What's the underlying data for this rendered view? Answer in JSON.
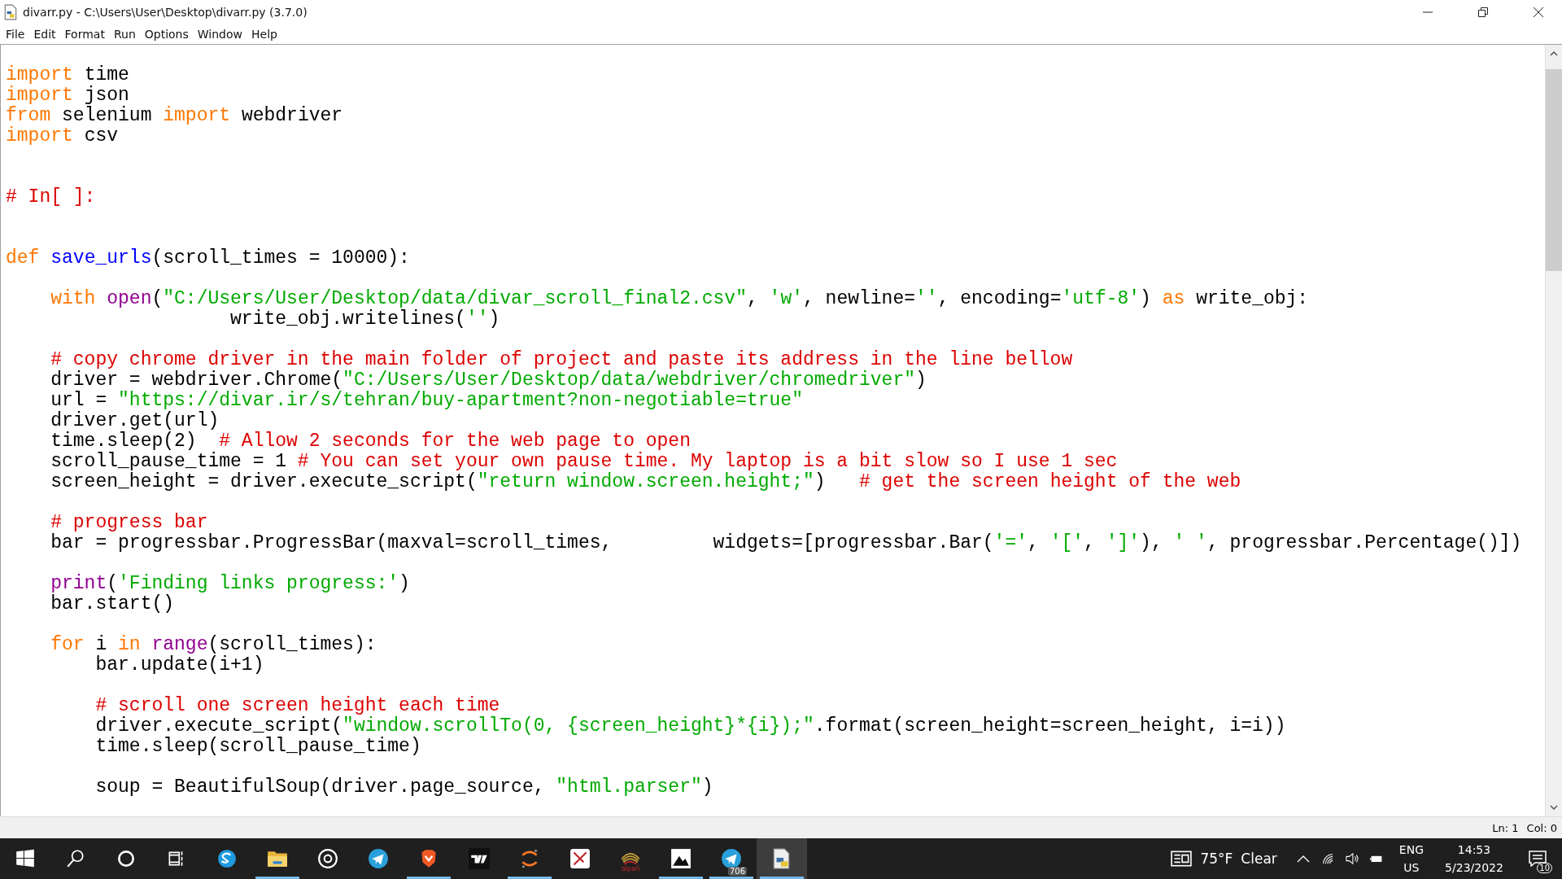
{
  "window": {
    "title": "divarr.py - C:\\Users\\User\\Desktop\\divarr.py (3.7.0)"
  },
  "menu": [
    "File",
    "Edit",
    "Format",
    "Run",
    "Options",
    "Window",
    "Help"
  ],
  "editor": {
    "blocks": [
      {
        "lines": [
          {
            "segments": [
              {
                "kind": "keyword",
                "text": "import"
              },
              {
                "kind": "plain",
                "text": " time"
              }
            ]
          },
          {
            "segments": [
              {
                "kind": "keyword",
                "text": "import"
              },
              {
                "kind": "plain",
                "text": " json"
              }
            ]
          },
          {
            "segments": [
              {
                "kind": "keyword",
                "text": "from"
              },
              {
                "kind": "plain",
                "text": " selenium "
              },
              {
                "kind": "keyword",
                "text": "import"
              },
              {
                "kind": "plain",
                "text": " webdriver"
              }
            ]
          },
          {
            "segments": [
              {
                "kind": "keyword",
                "text": "import"
              },
              {
                "kind": "plain",
                "text": " csv"
              }
            ]
          }
        ]
      },
      {
        "lines": [
          {
            "kind": "cell_marker",
            "segments": [
              {
                "kind": "comment",
                "text": "# In[ ]:"
              }
            ]
          }
        ]
      },
      {
        "lines": [
          {
            "segments": [
              {
                "kind": "keyword",
                "text": "def"
              },
              {
                "kind": "definition",
                "text": " save_urls"
              },
              {
                "kind": "plain",
                "text": "(scroll_times = 10000):"
              }
            ]
          }
        ]
      },
      {
        "lines": [
          {
            "segments": [
              {
                "kind": "keyword",
                "text": "    with"
              },
              {
                "kind": "builtin",
                "text": " open"
              },
              {
                "kind": "plain",
                "text": "("
              },
              {
                "kind": "string",
                "text": "\"C:/Users/User/Desktop/data/divar_scroll_final2.csv\""
              },
              {
                "kind": "plain",
                "text": ", "
              },
              {
                "kind": "string",
                "text": "'w'"
              },
              {
                "kind": "plain",
                "text": ", newline="
              },
              {
                "kind": "string",
                "text": "''"
              },
              {
                "kind": "plain",
                "text": ", encoding="
              },
              {
                "kind": "string",
                "text": "'utf-8'"
              },
              {
                "kind": "plain",
                "text": ")"
              },
              {
                "kind": "keyword",
                "text": " as"
              },
              {
                "kind": "plain",
                "text": " write_obj:"
              }
            ]
          },
          {
            "segments": [
              {
                "kind": "plain",
                "text": "                    write_obj.writelines("
              },
              {
                "kind": "string",
                "text": "''"
              },
              {
                "kind": "plain",
                "text": ")"
              }
            ]
          }
        ]
      },
      {
        "lines": [
          {
            "segments": [
              {
                "kind": "comment",
                "text": "    # copy chrome driver in the main folder of project and paste its address in the line bellow"
              }
            ]
          },
          {
            "segments": [
              {
                "kind": "plain",
                "text": "    driver = webdriver.Chrome("
              },
              {
                "kind": "string",
                "text": "\"C:/Users/User/Desktop/data/webdriver/chromedriver\""
              },
              {
                "kind": "plain",
                "text": ")"
              }
            ]
          },
          {
            "segments": [
              {
                "kind": "plain",
                "text": "    url = "
              },
              {
                "kind": "string",
                "text": "\"https://divar.ir/s/tehran/buy-apartment?non-negotiable=true\""
              }
            ]
          },
          {
            "segments": [
              {
                "kind": "plain",
                "text": "    driver.get(url)"
              }
            ]
          },
          {
            "segments": [
              {
                "kind": "plain",
                "text": "    time.sleep(2)  "
              },
              {
                "kind": "comment",
                "text": "# Allow 2 seconds for the web page to open"
              }
            ]
          },
          {
            "segments": [
              {
                "kind": "plain",
                "text": "    scroll_pause_time = 1 "
              },
              {
                "kind": "comment",
                "text": "# You can set your own pause time. My laptop is a bit slow so I use 1 sec"
              }
            ]
          },
          {
            "segments": [
              {
                "kind": "plain",
                "text": "    screen_height = driver.execute_script("
              },
              {
                "kind": "string",
                "text": "\"return window.screen.height;\""
              },
              {
                "kind": "plain",
                "text": ")   "
              },
              {
                "kind": "comment",
                "text": "# get the screen height of the web"
              }
            ]
          }
        ]
      },
      {
        "lines": [
          {
            "segments": [
              {
                "kind": "comment",
                "text": "    # progress bar"
              }
            ]
          },
          {
            "segments": [
              {
                "kind": "plain",
                "text": "    bar = progressbar.ProgressBar(maxval=scroll_times,         widgets=[progressbar.Bar("
              },
              {
                "kind": "string",
                "text": "'='"
              },
              {
                "kind": "plain",
                "text": ", "
              },
              {
                "kind": "string",
                "text": "'['"
              },
              {
                "kind": "plain",
                "text": ", "
              },
              {
                "kind": "string",
                "text": "']'"
              },
              {
                "kind": "plain",
                "text": "), "
              },
              {
                "kind": "string",
                "text": "' '"
              },
              {
                "kind": "plain",
                "text": ", progressbar.Percentage()])"
              }
            ]
          }
        ]
      },
      {
        "lines": [
          {
            "segments": [
              {
                "kind": "builtin",
                "text": "    print"
              },
              {
                "kind": "plain",
                "text": "("
              },
              {
                "kind": "string",
                "text": "'Finding links progress:'"
              },
              {
                "kind": "plain",
                "text": ")"
              }
            ]
          },
          {
            "segments": [
              {
                "kind": "plain",
                "text": "    bar.start()"
              }
            ]
          }
        ]
      },
      {
        "lines": [
          {
            "segments": [
              {
                "kind": "keyword",
                "text": "    for"
              },
              {
                "kind": "plain",
                "text": " i "
              },
              {
                "kind": "keyword",
                "text": "in"
              },
              {
                "kind": "builtin",
                "text": " range"
              },
              {
                "kind": "plain",
                "text": "(scroll_times):"
              }
            ]
          },
          {
            "segments": [
              {
                "kind": "plain",
                "text": "        bar.update(i+1)"
              }
            ]
          }
        ]
      },
      {
        "lines": [
          {
            "segments": [
              {
                "kind": "comment",
                "text": "        # scroll one screen height each time"
              }
            ]
          },
          {
            "segments": [
              {
                "kind": "plain",
                "text": "        driver.execute_script("
              },
              {
                "kind": "string",
                "text": "\"window.scrollTo(0, {screen_height}*{i});\""
              },
              {
                "kind": "plain",
                "text": ".format(screen_height=screen_height, i=i))"
              }
            ]
          },
          {
            "segments": [
              {
                "kind": "plain",
                "text": "        time.sleep(scroll_pause_time)"
              }
            ]
          }
        ]
      },
      {
        "lines": [
          {
            "segments": [
              {
                "kind": "plain",
                "text": "        soup = BeautifulSoup(driver.page_source, "
              },
              {
                "kind": "string",
                "text": "\"html.parser\""
              },
              {
                "kind": "plain",
                "text": ")"
              }
            ]
          }
        ]
      }
    ]
  },
  "status_bar": {
    "line": "Ln: 1",
    "column": "Col: 0"
  },
  "taskbar": {
    "apps": [
      {
        "kind": "start",
        "running": false
      },
      {
        "kind": "search",
        "running": false
      },
      {
        "kind": "cortana",
        "running": false
      },
      {
        "kind": "taskview",
        "running": false
      },
      {
        "kind": "skype",
        "running": false
      },
      {
        "kind": "explorer",
        "running": true
      },
      {
        "kind": "disc",
        "running": false
      },
      {
        "kind": "telegram",
        "running": false
      },
      {
        "kind": "brave",
        "running": true
      },
      {
        "kind": "tv",
        "running": false
      },
      {
        "kind": "jupyter",
        "running": true
      },
      {
        "kind": "redapp",
        "running": false
      },
      {
        "kind": "alpari",
        "running": false,
        "label": "alpari"
      },
      {
        "kind": "photos",
        "running": true
      },
      {
        "kind": "telegram",
        "running": true,
        "badge": "706"
      },
      {
        "kind": "python",
        "running": true,
        "active": true
      }
    ],
    "weather": {
      "temperature": "75°F",
      "condition": "Clear"
    },
    "language": {
      "code": "ENG",
      "region": "US"
    },
    "clock": {
      "time": "14:53",
      "date": "5/23/2022"
    },
    "notifications": {
      "count": "10"
    }
  }
}
